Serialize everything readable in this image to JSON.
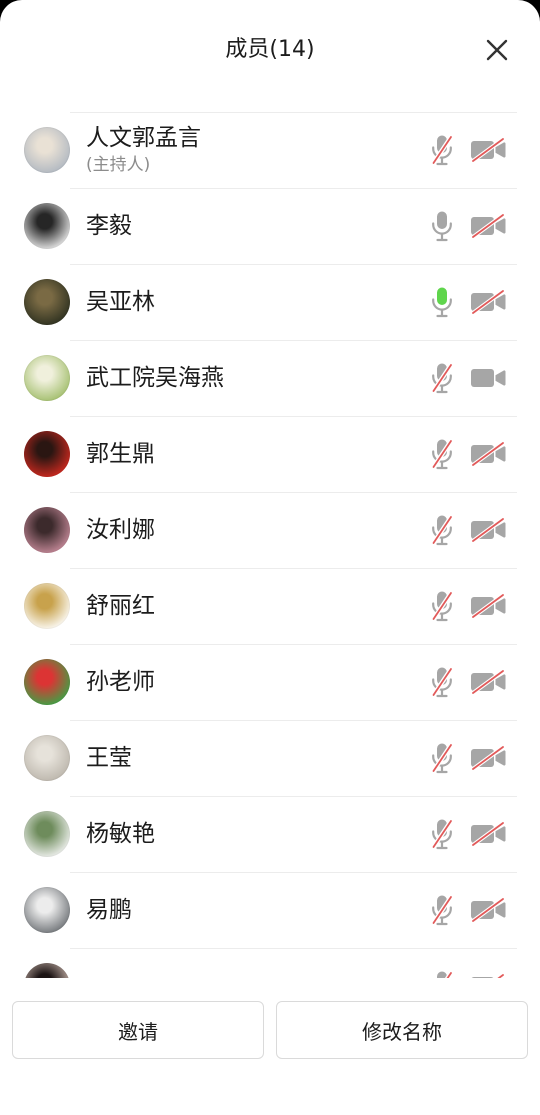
{
  "header": {
    "title": "成员(14)"
  },
  "colors": {
    "icon_gray": "#a6a6a6",
    "muted_red": "#e25a5a",
    "speaking_green": "#5fd54c",
    "divider": "#ececec",
    "text": "#1c1c1c",
    "subtext": "#8c8c8c"
  },
  "members": [
    {
      "name": "人文郭孟言",
      "role": "(主持人)",
      "mic_icon": "mic-muted-icon",
      "camera_icon": "camera-off-icon",
      "avatar": {
        "fg": "#e9e1d5",
        "bg": "#aeb6c0"
      }
    },
    {
      "name": "李毅",
      "mic_icon": "mic-icon",
      "camera_icon": "camera-off-icon",
      "avatar": {
        "fg": "#262626",
        "bg": "#efefef"
      }
    },
    {
      "name": "吴亚林",
      "mic_icon": "mic-speaking-icon",
      "camera_icon": "camera-off-icon",
      "avatar": {
        "fg": "#7a6a44",
        "bg": "#2a2e1e"
      }
    },
    {
      "name": "武工院吴海燕",
      "mic_icon": "mic-muted-icon",
      "camera_icon": "camera-icon",
      "avatar": {
        "fg": "#f0f0dc",
        "bg": "#9fbc68"
      }
    },
    {
      "name": "郭生鼎",
      "mic_icon": "mic-muted-icon",
      "camera_icon": "camera-off-icon",
      "avatar": {
        "fg": "#2a1612",
        "bg": "#d42a20"
      }
    },
    {
      "name": "汝利娜",
      "mic_icon": "mic-muted-icon",
      "camera_icon": "camera-off-icon",
      "avatar": {
        "fg": "#3c2a2c",
        "bg": "#c98c9c"
      }
    },
    {
      "name": "舒丽红",
      "mic_icon": "mic-muted-icon",
      "camera_icon": "camera-off-icon",
      "avatar": {
        "fg": "#c8a24c",
        "bg": "#ffffff"
      }
    },
    {
      "name": "孙老师",
      "mic_icon": "mic-muted-icon",
      "camera_icon": "camera-off-icon",
      "avatar": {
        "fg": "#dc3434",
        "bg": "#38a646"
      }
    },
    {
      "name": "王莹",
      "mic_icon": "mic-muted-icon",
      "camera_icon": "camera-off-icon",
      "avatar": {
        "fg": "#e6e2da",
        "bg": "#bab4aa"
      }
    },
    {
      "name": "杨敏艳",
      "mic_icon": "mic-muted-icon",
      "camera_icon": "camera-off-icon",
      "avatar": {
        "fg": "#6e8c5c",
        "bg": "#f5f5f5"
      }
    },
    {
      "name": "易鹏",
      "mic_icon": "mic-muted-icon",
      "camera_icon": "camera-off-icon",
      "avatar": {
        "fg": "#ececec",
        "bg": "#6c7074"
      }
    },
    {
      "mic_icon": "mic-muted-icon",
      "camera_icon": "camera-off-icon",
      "avatar": {
        "fg": "#1c1414",
        "bg": "#d9c4ba"
      }
    }
  ],
  "footer": {
    "invite_label": "邀请",
    "rename_label": "修改名称"
  }
}
